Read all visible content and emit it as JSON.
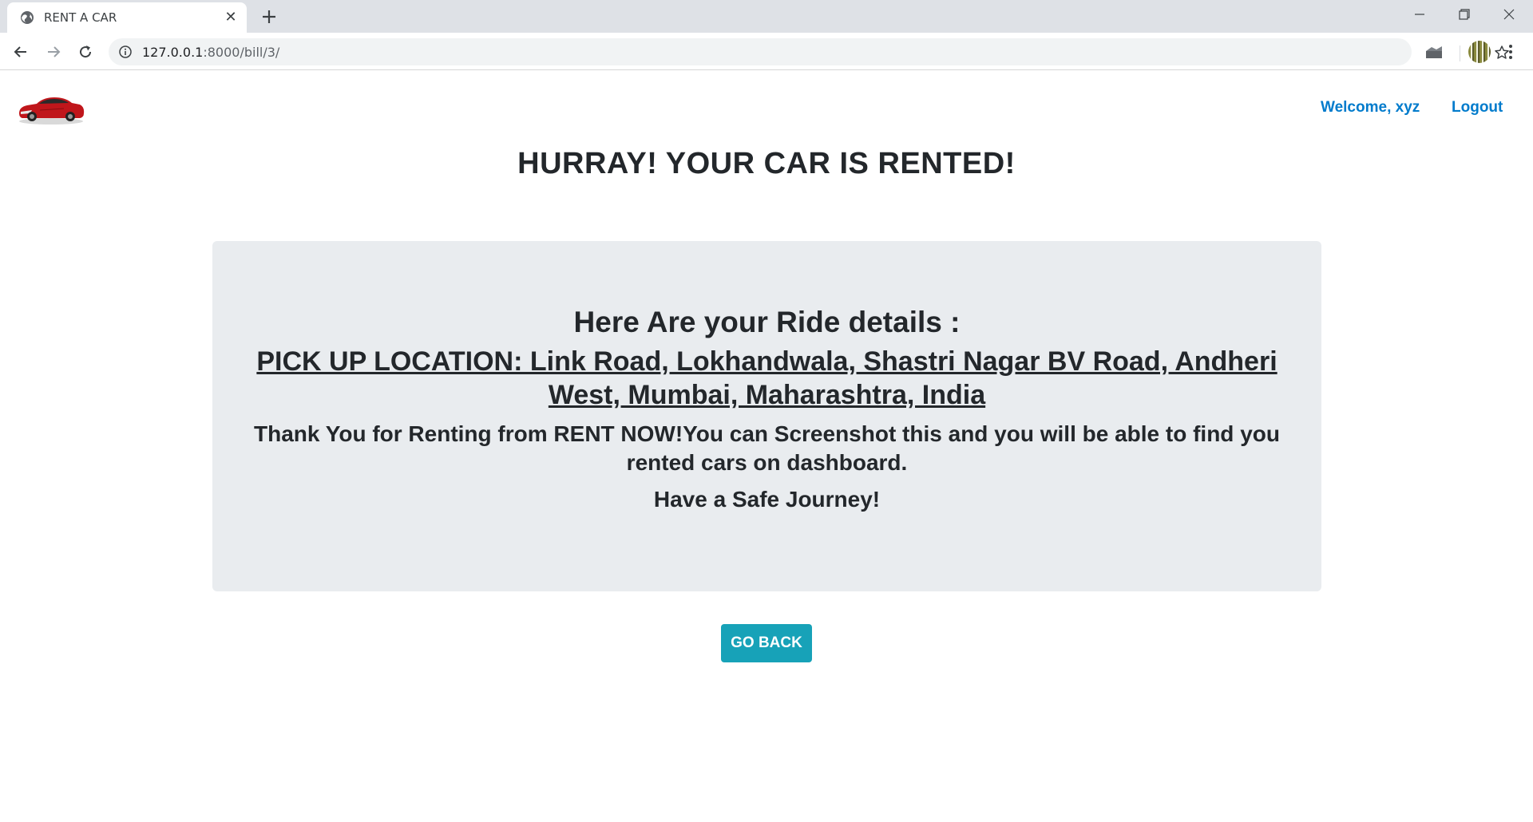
{
  "browser": {
    "tab_title": "RENT A CAR",
    "url_host": "127.0.0.1",
    "url_rest": ":8000/bill/3/"
  },
  "nav": {
    "welcome": "Welcome, xyz",
    "logout": "Logout"
  },
  "headline": "HURRAY! YOUR CAR IS RENTED!",
  "details": {
    "title": "Here Are your Ride details :",
    "pickup": "PICK UP LOCATION: Link Road, Lokhandwala, Shastri Nagar BV Road, Andheri West, Mumbai, Maharashtra, India",
    "thanks": "Thank You for Renting from RENT NOW!You can Screenshot this and you will be able to find you rented cars on dashboard.",
    "safe": "Have a Safe Journey!"
  },
  "go_back_label": "GO BACK",
  "colors": {
    "link": "#007bcc",
    "button": "#17a2b8",
    "card_bg": "#e9ecef"
  }
}
